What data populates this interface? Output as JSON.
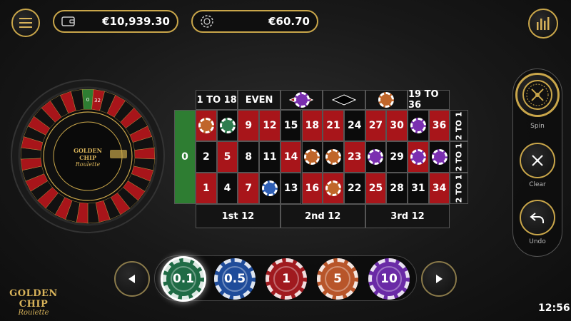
{
  "header": {
    "balance": "€10,939.30",
    "bet_total": "€60.70",
    "clock": "12:56"
  },
  "logo": {
    "line1": "GOLDEN CHIP",
    "line2": "Roulette"
  },
  "wheel": {
    "logo_line1": "GOLDEN CHIP",
    "logo_line2": "Roulette",
    "visible_numbers": [
      "0",
      "32"
    ]
  },
  "table": {
    "zero": "0",
    "top_bets": [
      "1 TO 18",
      "EVEN",
      "",
      "",
      "",
      "19 TO 36"
    ],
    "rows": [
      [
        {
          "n": "3",
          "c": "red"
        },
        {
          "n": "6",
          "c": "black"
        },
        {
          "n": "9",
          "c": "red"
        },
        {
          "n": "12",
          "c": "red"
        },
        {
          "n": "15",
          "c": "black"
        },
        {
          "n": "18",
          "c": "red"
        },
        {
          "n": "21",
          "c": "red"
        },
        {
          "n": "24",
          "c": "black"
        },
        {
          "n": "27",
          "c": "red"
        },
        {
          "n": "30",
          "c": "red"
        },
        {
          "n": "33",
          "c": "black"
        },
        {
          "n": "36",
          "c": "red"
        }
      ],
      [
        {
          "n": "2",
          "c": "black"
        },
        {
          "n": "5",
          "c": "red"
        },
        {
          "n": "8",
          "c": "black"
        },
        {
          "n": "11",
          "c": "black"
        },
        {
          "n": "14",
          "c": "red"
        },
        {
          "n": "17",
          "c": "black"
        },
        {
          "n": "20",
          "c": "black"
        },
        {
          "n": "23",
          "c": "red"
        },
        {
          "n": "26",
          "c": "black"
        },
        {
          "n": "29",
          "c": "black"
        },
        {
          "n": "32",
          "c": "red"
        },
        {
          "n": "35",
          "c": "black"
        }
      ],
      [
        {
          "n": "1",
          "c": "red"
        },
        {
          "n": "4",
          "c": "black"
        },
        {
          "n": "7",
          "c": "red"
        },
        {
          "n": "10",
          "c": "black"
        },
        {
          "n": "13",
          "c": "black"
        },
        {
          "n": "16",
          "c": "red"
        },
        {
          "n": "19",
          "c": "red"
        },
        {
          "n": "22",
          "c": "black"
        },
        {
          "n": "25",
          "c": "red"
        },
        {
          "n": "28",
          "c": "black"
        },
        {
          "n": "31",
          "c": "black"
        },
        {
          "n": "34",
          "c": "red"
        }
      ]
    ],
    "columns": [
      "2 TO 1",
      "2 TO 1",
      "2 TO 1"
    ],
    "dozens": [
      "1st 12",
      "2nd 12",
      "3rd 12"
    ],
    "placed_chips": [
      {
        "cell": "3",
        "color": "#c0662a"
      },
      {
        "cell": "6",
        "color": "#2e7d4f"
      },
      {
        "cell": "17",
        "color": "#c0662a"
      },
      {
        "cell": "20",
        "color": "#c0662a"
      },
      {
        "cell": "26",
        "color": "#7a2fb0"
      },
      {
        "cell": "32",
        "color": "#7a2fb0"
      },
      {
        "cell": "33",
        "color": "#7a2fb0"
      },
      {
        "cell": "35",
        "color": "#7a2fb0"
      },
      {
        "cell": "10",
        "color": "#2f5fb5"
      },
      {
        "cell": "19",
        "color": "#c0662a"
      },
      {
        "cell": "top-red",
        "color": "#7a2fb0"
      },
      {
        "cell": "top-odd",
        "color": "#c0662a"
      }
    ]
  },
  "controls": {
    "spin": "Spin",
    "clear": "Clear",
    "undo": "Undo"
  },
  "chips": [
    {
      "label": "0.1",
      "color": "#1f6b45",
      "selected": true
    },
    {
      "label": "0.5",
      "color": "#1f4c9a",
      "selected": false
    },
    {
      "label": "1",
      "color": "#a01a1f",
      "selected": false
    },
    {
      "label": "5",
      "color": "#b8552a",
      "selected": false
    },
    {
      "label": "10",
      "color": "#6a2aa6",
      "selected": false
    }
  ]
}
